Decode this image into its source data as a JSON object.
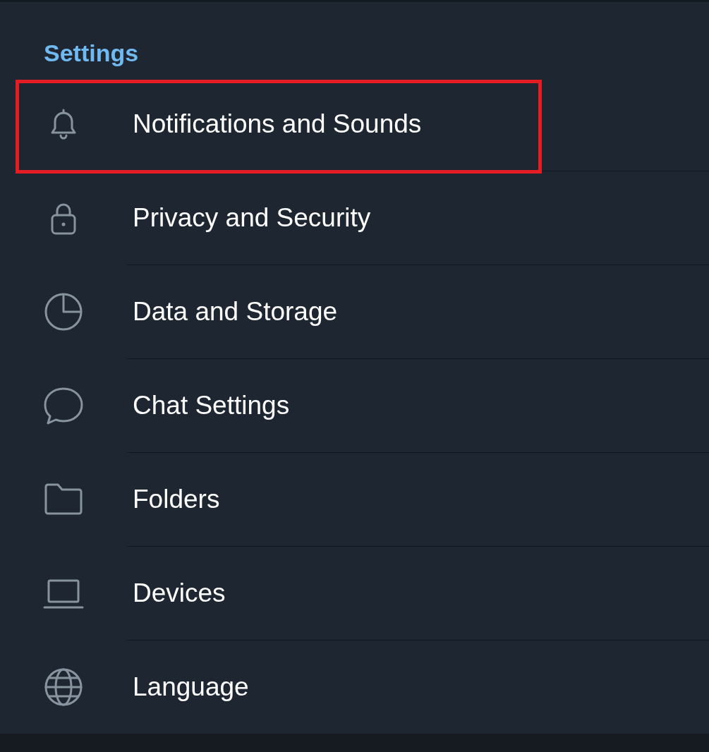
{
  "section": {
    "title": "Settings"
  },
  "items": [
    {
      "label": "Notifications and Sounds",
      "highlighted": true
    },
    {
      "label": "Privacy and Security",
      "highlighted": false
    },
    {
      "label": "Data and Storage",
      "highlighted": false
    },
    {
      "label": "Chat Settings",
      "highlighted": false
    },
    {
      "label": "Folders",
      "highlighted": false
    },
    {
      "label": "Devices",
      "highlighted": false
    },
    {
      "label": "Language",
      "highlighted": false
    }
  ]
}
